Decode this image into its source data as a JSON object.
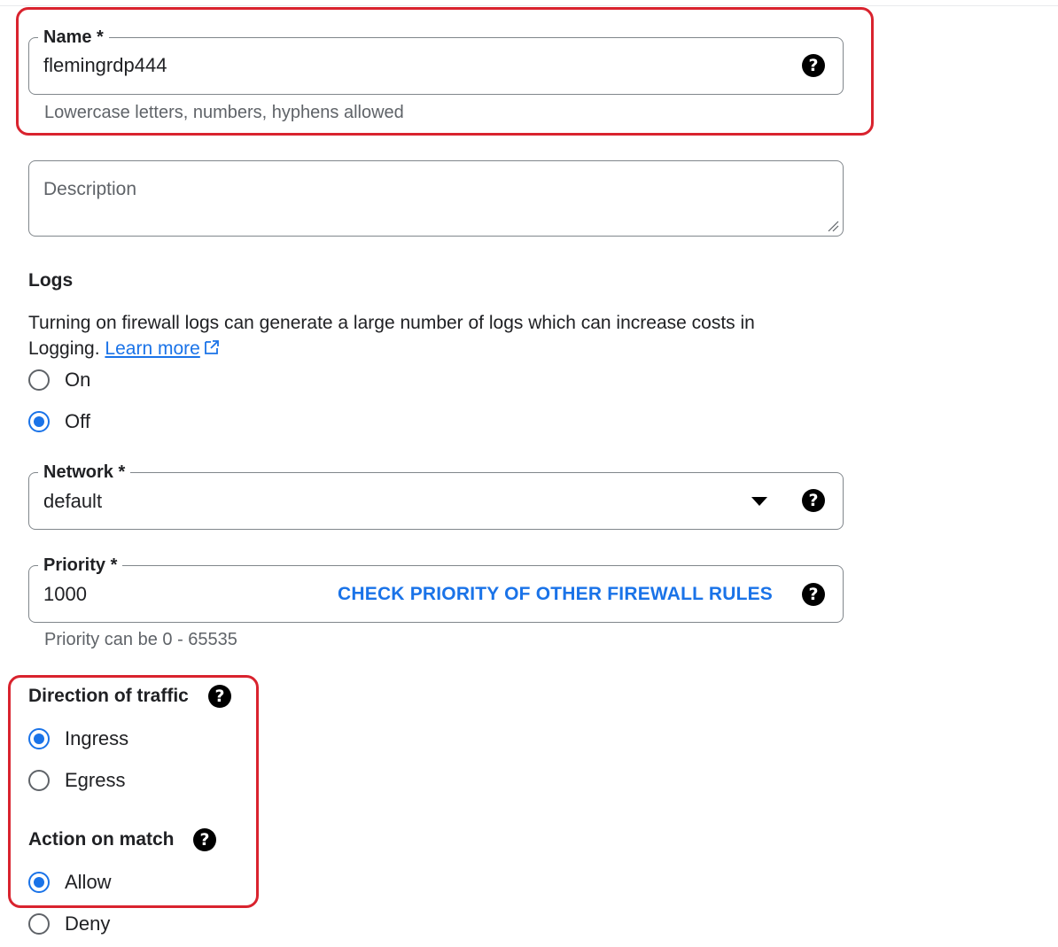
{
  "name_field": {
    "label": "Name *",
    "value": "flemingrdp444",
    "hint": "Lowercase letters, numbers, hyphens allowed",
    "help_icon": "help-circle-icon"
  },
  "description_field": {
    "placeholder": "Description",
    "value": ""
  },
  "logs": {
    "title": "Logs",
    "text": " Turning on firewall logs can generate a large number of logs which can increase costs in Logging.",
    "learn_more": "Learn more",
    "learn_more_icon": "external-link-icon",
    "options": [
      {
        "label": "On",
        "selected": false
      },
      {
        "label": "Off",
        "selected": true
      }
    ]
  },
  "network_field": {
    "label": "Network *",
    "value": "default",
    "dropdown_icon": "dropdown-arrow-icon",
    "help_icon": "help-circle-icon"
  },
  "priority_field": {
    "label": "Priority *",
    "value": "1000",
    "action": "CHECK PRIORITY OF OTHER FIREWALL RULES",
    "hint": "Priority can be 0 - 65535",
    "help_icon": "help-circle-icon"
  },
  "direction": {
    "title": "Direction of traffic",
    "help_icon": "help-circle-icon",
    "options": [
      {
        "label": "Ingress",
        "selected": true
      },
      {
        "label": "Egress",
        "selected": false
      }
    ]
  },
  "action_on_match": {
    "title": "Action on match",
    "help_icon": "help-circle-icon",
    "options": [
      {
        "label": "Allow",
        "selected": true
      },
      {
        "label": "Deny",
        "selected": false
      }
    ]
  },
  "colors": {
    "accent": "#1a73e8",
    "highlight_border": "#d9232e",
    "text": "#202124",
    "secondary_text": "#5f6368"
  }
}
